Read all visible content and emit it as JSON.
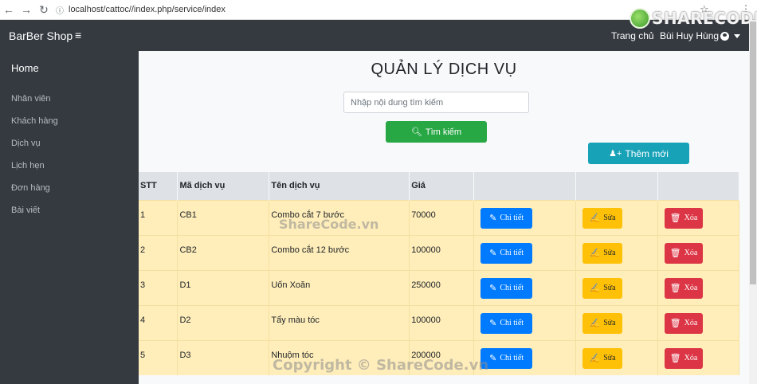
{
  "browser": {
    "url": "localhost/cattoc//index.php/service/index"
  },
  "watermark": {
    "logo_text": "SHARECODE.vn",
    "center_text": "ShareCode.vn",
    "copyright_text": "Copyright © ShareCode.vn"
  },
  "navbar": {
    "brand": "BarBer Shop",
    "home_link": "Trang chủ",
    "user_name": "Bùi Huy Hùng"
  },
  "sidebar": {
    "home": "Home",
    "items": [
      {
        "label": "Nhân viên"
      },
      {
        "label": "Khách hàng"
      },
      {
        "label": "Dịch vụ"
      },
      {
        "label": "Lịch hẹn"
      },
      {
        "label": "Đơn hàng"
      },
      {
        "label": "Bài viết"
      }
    ]
  },
  "main": {
    "title": "QUẢN LÝ DỊCH VỤ",
    "search_placeholder": "Nhập nội dung tìm kiếm",
    "search_button": "Tìm kiếm",
    "add_button": "Thêm mới"
  },
  "table": {
    "headers": [
      "STT",
      "Mã dịch vụ",
      "Tên dịch vụ",
      "Giá"
    ],
    "actions": {
      "detail": "Chi tiết",
      "edit": "Sửa",
      "delete": "Xóa"
    },
    "rows": [
      {
        "stt": "1",
        "code": "CB1",
        "name": "Combo cắt 7 bước",
        "price": "70000"
      },
      {
        "stt": "2",
        "code": "CB2",
        "name": "Combo cắt 12 bước",
        "price": "100000"
      },
      {
        "stt": "3",
        "code": "D1",
        "name": "Uốn Xoăn",
        "price": "250000"
      },
      {
        "stt": "4",
        "code": "D2",
        "name": "Tẩy màu tóc",
        "price": "100000"
      },
      {
        "stt": "5",
        "code": "D3",
        "name": "Nhuộm tóc",
        "price": "200000"
      }
    ]
  },
  "colors": {
    "navbar": "#343a40",
    "row_bg": "#ffeeba",
    "search": "#28a745",
    "add": "#17a2b8",
    "detail": "#007bff",
    "edit": "#ffc107",
    "delete": "#dc3545"
  },
  "icons": {
    "back": "arrow-left-icon",
    "forward": "arrow-right-icon",
    "reload": "reload-icon",
    "menu": "hamburger-icon",
    "user": "user-circle-icon",
    "search": "search-icon",
    "add_user": "user-plus-icon",
    "detail": "edit-square-icon",
    "edit": "pencil-icon",
    "delete": "trash-icon"
  }
}
